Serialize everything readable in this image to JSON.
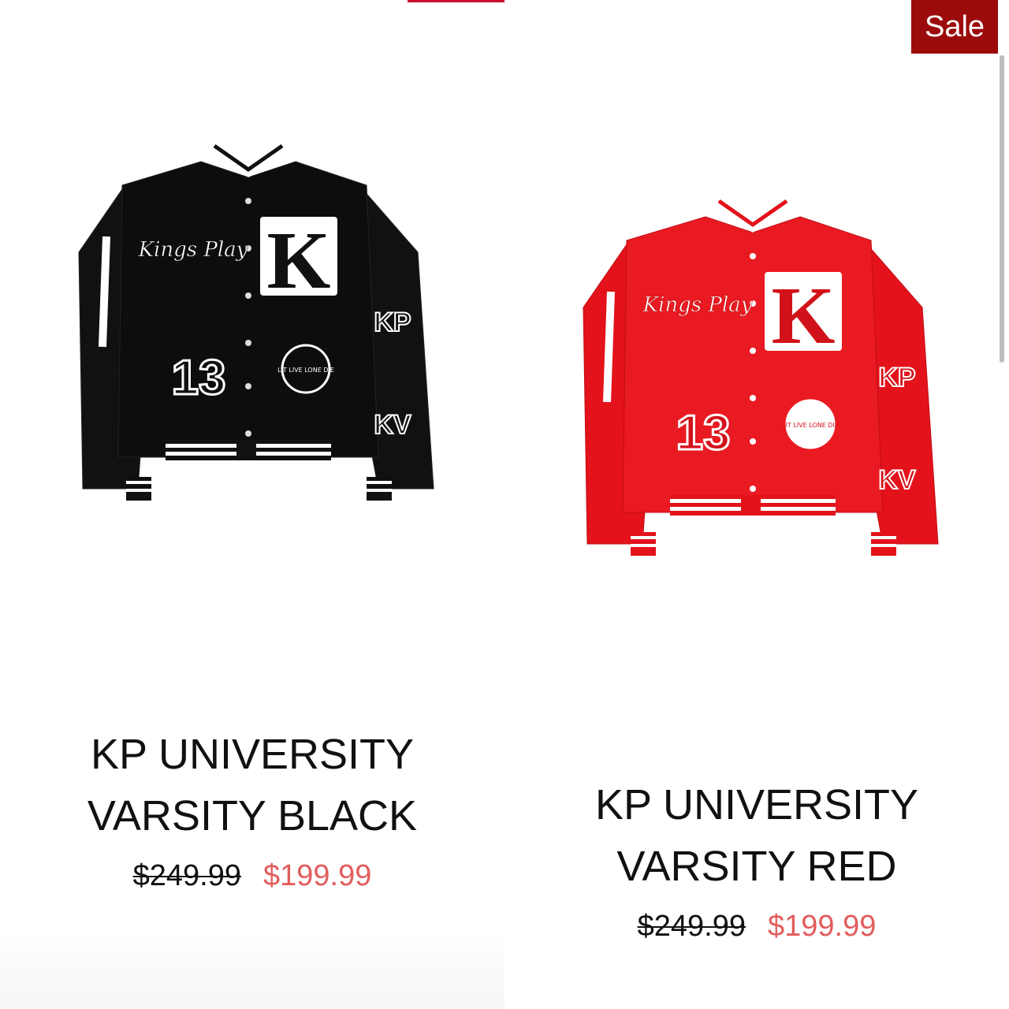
{
  "badge": {
    "label": "Sale"
  },
  "colors": {
    "accent": "#9b0b0b",
    "sale_price": "#e25d5d"
  },
  "products": [
    {
      "title_line1": "KP UNIVERSITY",
      "title_line2": "VARSITY BLACK",
      "original_price": "$249.99",
      "sale_price": "$199.99",
      "image": {
        "icon": "varsity-jacket-black",
        "chest_script": "Kings Play",
        "chest_letter": "K",
        "pocket_number": "13",
        "circle_text": "LIT LIVE LONE DIE",
        "sleeve_patch_1": "KP",
        "sleeve_patch_2": "KV"
      }
    },
    {
      "title_line1": "KP UNIVERSITY",
      "title_line2": "VARSITY RED",
      "original_price": "$249.99",
      "sale_price": "$199.99",
      "image": {
        "icon": "varsity-jacket-red",
        "chest_script": "Kings Play",
        "chest_letter": "K",
        "pocket_number": "13",
        "circle_text": "LIT LIVE LONE DIE",
        "sleeve_patch_1": "KP",
        "sleeve_patch_2": "KV"
      }
    }
  ]
}
